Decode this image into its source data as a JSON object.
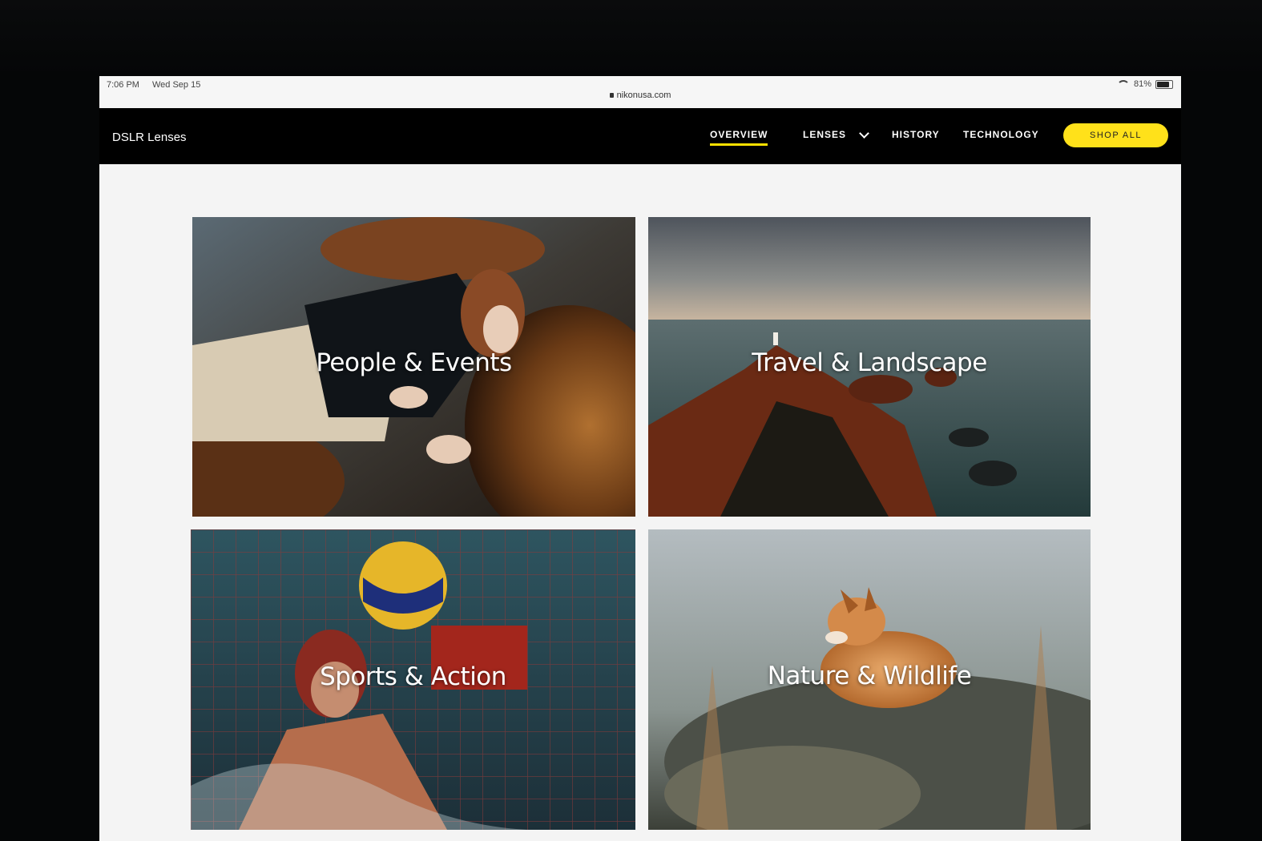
{
  "status_bar": {
    "time": "7:06 PM",
    "date": "Wed Sep 15",
    "url": "nikonusa.com",
    "battery": "81%",
    "battery_level": 0.81
  },
  "nav": {
    "site_title": "DSLR Lenses",
    "items": [
      {
        "label": "OVERVIEW",
        "active": true
      },
      {
        "label": "LENSES",
        "has_dropdown": true
      },
      {
        "label": "HISTORY"
      },
      {
        "label": "TECHNOLOGY"
      }
    ],
    "cta_label": "SHOP ALL",
    "accent_color": "#ffe11a"
  },
  "tiles": [
    {
      "label": "People & Events"
    },
    {
      "label": "Travel & Landscape"
    },
    {
      "label": "Sports & Action"
    },
    {
      "label": "Nature & Wildlife"
    }
  ]
}
